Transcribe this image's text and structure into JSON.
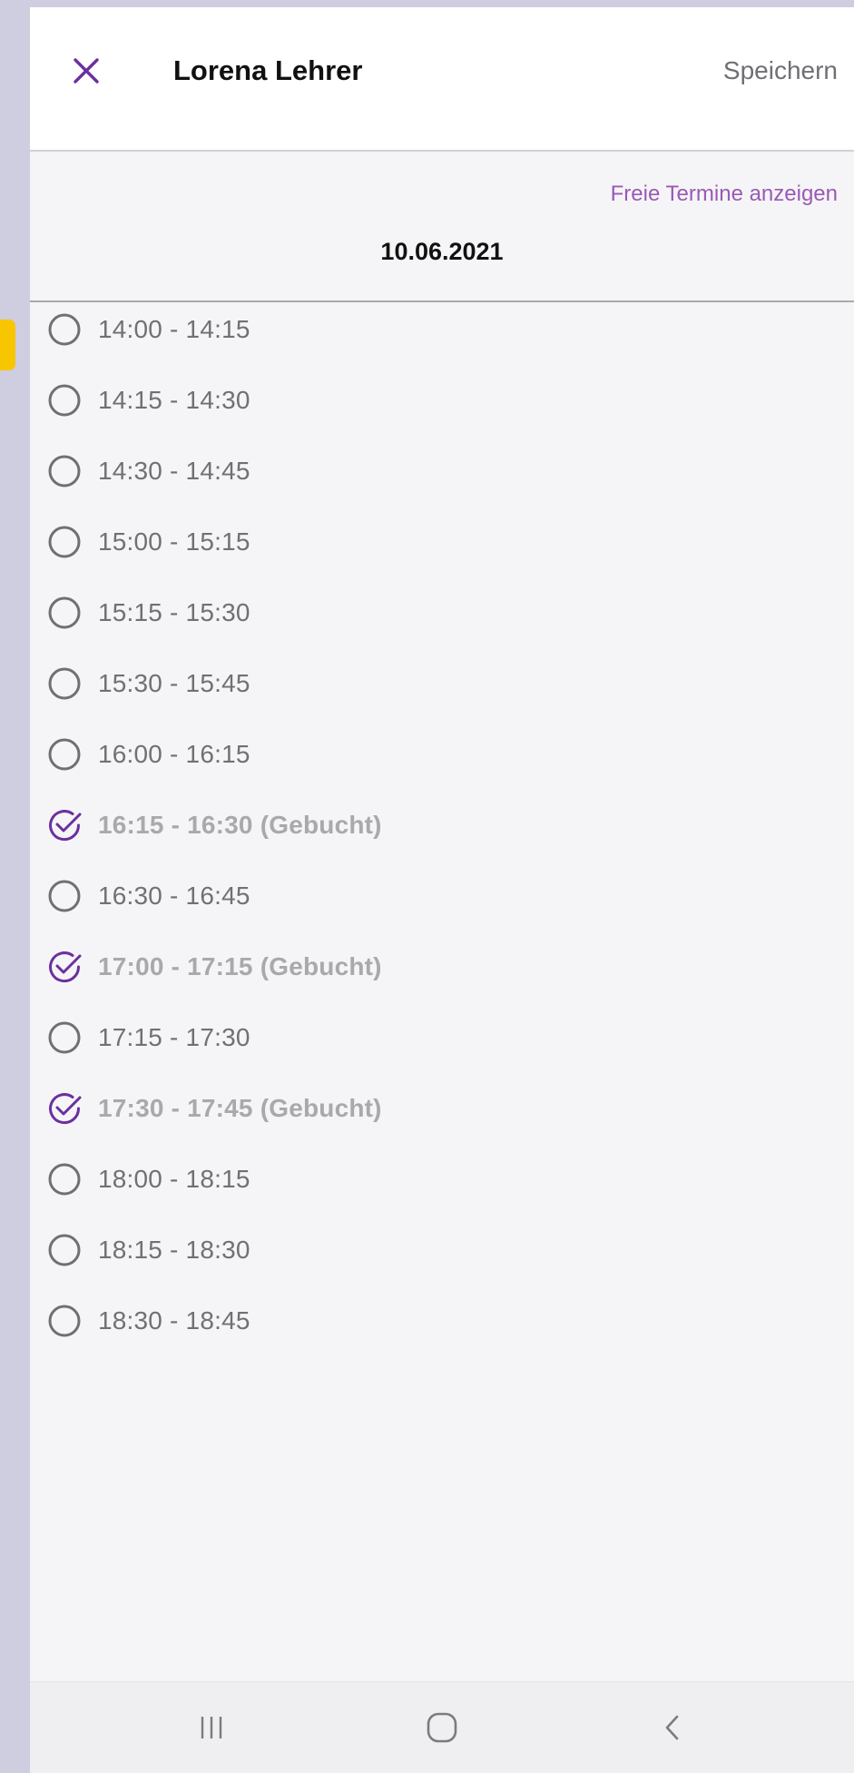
{
  "header": {
    "title": "Lorena Lehrer",
    "save_label": "Speichern",
    "close_icon": "close-icon",
    "accent_color": "#6b2fa0"
  },
  "subheader": {
    "free_slots_link": "Freie Termine anzeigen",
    "date": "10.06.2021"
  },
  "slots": [
    {
      "label": "14:00 - 14:15",
      "booked": false
    },
    {
      "label": "14:15 - 14:30",
      "booked": false
    },
    {
      "label": "14:30 - 14:45",
      "booked": false
    },
    {
      "label": "15:00 - 15:15",
      "booked": false
    },
    {
      "label": "15:15 - 15:30",
      "booked": false
    },
    {
      "label": "15:30 - 15:45",
      "booked": false
    },
    {
      "label": "16:00 - 16:15",
      "booked": false
    },
    {
      "label": "16:15 - 16:30 (Gebucht)",
      "booked": true
    },
    {
      "label": "16:30 - 16:45",
      "booked": false
    },
    {
      "label": "17:00 - 17:15 (Gebucht)",
      "booked": true
    },
    {
      "label": "17:15 - 17:30",
      "booked": false
    },
    {
      "label": "17:30 - 17:45 (Gebucht)",
      "booked": true
    },
    {
      "label": "18:00 - 18:15",
      "booked": false
    },
    {
      "label": "18:15 - 18:30",
      "booked": false
    },
    {
      "label": "18:30 - 18:45",
      "booked": false
    }
  ],
  "nav": {
    "recents_icon": "recent-apps-icon",
    "home_icon": "home-icon",
    "back_icon": "back-icon"
  }
}
